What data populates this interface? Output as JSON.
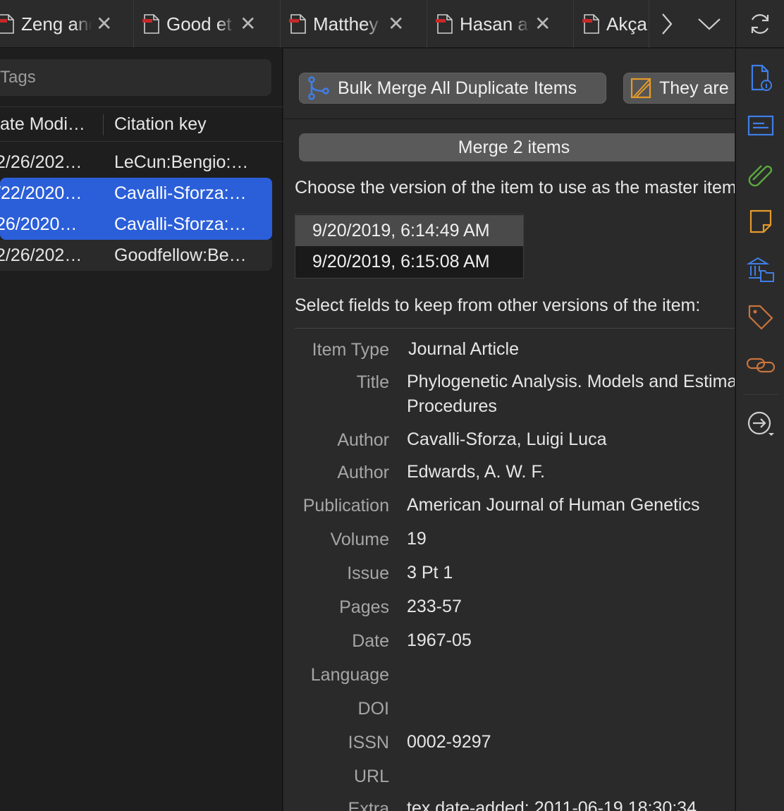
{
  "tabs": [
    {
      "label": "Zeng and"
    },
    {
      "label": "Good et al."
    },
    {
      "label": "Matthey"
    },
    {
      "label": "Hasan and"
    },
    {
      "label": "Akçay"
    }
  ],
  "tabs_scroll_right": "next-tabs",
  "tabs_menu": "tabs-dropdown",
  "left": {
    "tags_placeholder": "Tags",
    "columns": [
      "ate Modi…",
      "Citation key"
    ],
    "rows": [
      {
        "date": "2/26/202…",
        "key": "LeCun:Bengio:…",
        "selected": false
      },
      {
        "date": "/22/2020…",
        "key": "Cavalli-Sforza:…",
        "selected": true
      },
      {
        "date": "26/2020…",
        "key": "Cavalli-Sforza:…",
        "selected": true
      },
      {
        "date": "2/26/202…",
        "key": "Goodfellow:Be…",
        "selected": false
      }
    ]
  },
  "merge": {
    "bulk_button": "Bulk Merge All Duplicate Items",
    "not_dup_button": "They are not duplicates",
    "merge_bar": "Merge 2 items",
    "choose_prompt": "Choose the version of the item to use as the master item:",
    "versions": [
      "9/20/2019, 6:14:49 AM",
      "9/20/2019, 6:15:08 AM"
    ],
    "select_prompt": "Select fields to keep from other versions of the item:",
    "fields": [
      {
        "label": "Item Type",
        "value": "Journal Article"
      },
      {
        "label": "Title",
        "value": "Phylogenetic Analysis. Models and Estimation Procedures",
        "value_line2": "Procedures"
      },
      {
        "label": "Author",
        "value": "Cavalli-Sforza, Luigi Luca"
      },
      {
        "label": "Author",
        "value": "Edwards, A. W. F."
      },
      {
        "label": "Publication",
        "value": "American Journal of Human Genetics"
      },
      {
        "label": "Volume",
        "value": "19"
      },
      {
        "label": "Issue",
        "value": "3 Pt 1"
      },
      {
        "label": "Pages",
        "value": "233-57"
      },
      {
        "label": "Date",
        "value": "1967-05"
      },
      {
        "label": "Language",
        "value": ""
      },
      {
        "label": "DOI",
        "value": ""
      },
      {
        "label": "ISSN",
        "value": "0002-9297"
      },
      {
        "label": "URL",
        "value": ""
      },
      {
        "label": "Extra",
        "value": "tex.date-added: 2011-06-19 18:30:34"
      }
    ]
  },
  "sidenav_icons": [
    "info-icon",
    "abstract-icon",
    "attachments-icon",
    "notes-icon",
    "libraries-collections-icon",
    "tags-icon",
    "related-icon",
    "locate-icon"
  ],
  "colors": {
    "selection": "#2b5fd9",
    "pdf_red": "#c62828",
    "accent_blue": "#3f7ee8",
    "green": "#5aa93f",
    "orange": "#e59a2c",
    "copper": "#c8733c"
  }
}
